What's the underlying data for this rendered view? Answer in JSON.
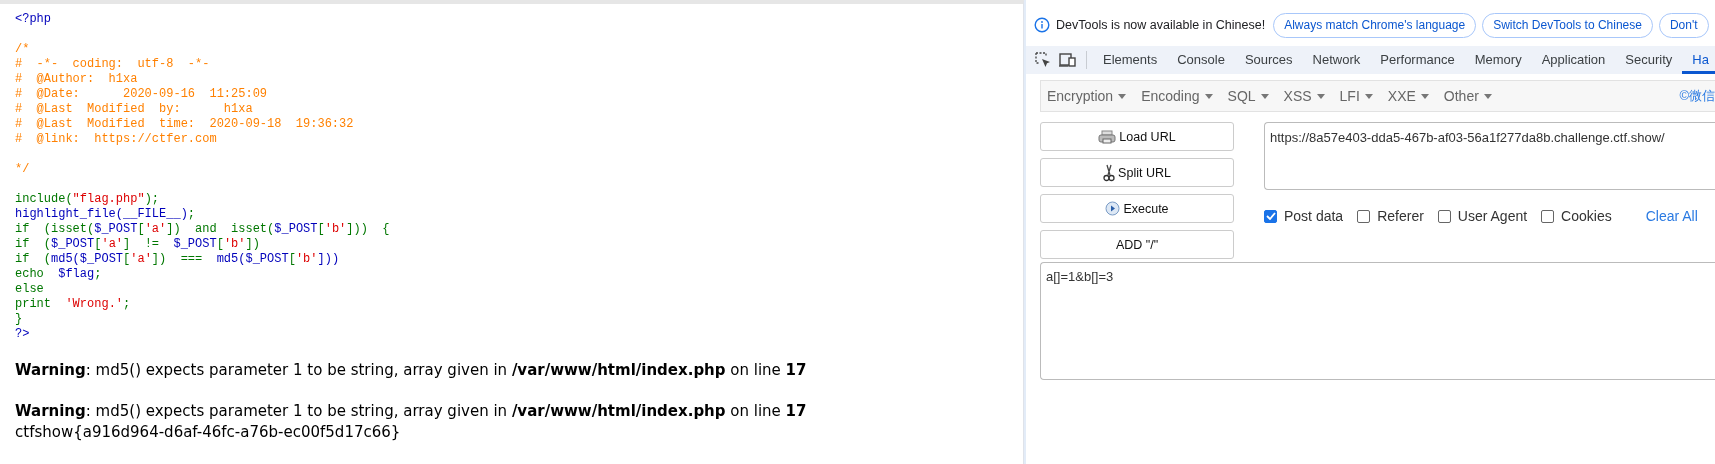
{
  "code": {
    "blocks": [
      {
        "lines": [
          [
            {
              "text": "<?php",
              "kind": "default"
            }
          ]
        ]
      },
      {
        "lines": [
          [
            {
              "text": "/*",
              "kind": "comment"
            }
          ],
          [
            {
              "text": "#  -*-  coding:  utf-8  -*-",
              "kind": "comment"
            }
          ],
          [
            {
              "text": "#  @Author:  h1xa",
              "kind": "comment"
            }
          ],
          [
            {
              "text": "#  @Date:      2020-09-16  11:25:09",
              "kind": "comment"
            }
          ],
          [
            {
              "text": "#  @Last  Modified  by:      h1xa",
              "kind": "comment"
            }
          ],
          [
            {
              "text": "#  @Last  Modified  time:  2020-09-18  19:36:32",
              "kind": "comment"
            }
          ],
          [
            {
              "text": "#  @link:  https://ctfer.com",
              "kind": "comment"
            }
          ]
        ]
      },
      {
        "lines": [
          [
            {
              "text": "*/",
              "kind": "comment"
            }
          ]
        ]
      },
      {
        "lines": [
          [
            {
              "text": "include(",
              "kind": "keyword"
            },
            {
              "text": "\"flag.php\"",
              "kind": "string"
            },
            {
              "text": ");",
              "kind": "keyword"
            }
          ],
          [
            {
              "text": "highlight_file(__FILE__)",
              "kind": "default"
            },
            {
              "text": ";",
              "kind": "keyword"
            }
          ],
          [
            {
              "text": "if  (isset(",
              "kind": "keyword"
            },
            {
              "text": "$_POST",
              "kind": "default"
            },
            {
              "text": "[",
              "kind": "keyword"
            },
            {
              "text": "'a'",
              "kind": "string"
            },
            {
              "text": "])  and  isset(",
              "kind": "keyword"
            },
            {
              "text": "$_POST",
              "kind": "default"
            },
            {
              "text": "[",
              "kind": "keyword"
            },
            {
              "text": "'b'",
              "kind": "string"
            },
            {
              "text": "]))  {",
              "kind": "keyword"
            }
          ],
          [
            {
              "text": "if  (",
              "kind": "keyword"
            },
            {
              "text": "$_POST",
              "kind": "default"
            },
            {
              "text": "[",
              "kind": "keyword"
            },
            {
              "text": "'a'",
              "kind": "string"
            },
            {
              "text": "]  !=  ",
              "kind": "keyword"
            },
            {
              "text": "$_POST",
              "kind": "default"
            },
            {
              "text": "[",
              "kind": "keyword"
            },
            {
              "text": "'b'",
              "kind": "string"
            },
            {
              "text": "])",
              "kind": "keyword"
            }
          ],
          [
            {
              "text": "if  (",
              "kind": "keyword"
            },
            {
              "text": "md5($_POST",
              "kind": "default"
            },
            {
              "text": "[",
              "kind": "keyword"
            },
            {
              "text": "'a'",
              "kind": "string"
            },
            {
              "text": "])  ===  ",
              "kind": "keyword"
            },
            {
              "text": "md5($_POST",
              "kind": "default"
            },
            {
              "text": "[",
              "kind": "keyword"
            },
            {
              "text": "'b'",
              "kind": "string"
            },
            {
              "text": "]))",
              "kind": "default"
            }
          ],
          [
            {
              "text": "echo  ",
              "kind": "keyword"
            },
            {
              "text": "$flag",
              "kind": "default"
            },
            {
              "text": ";",
              "kind": "keyword"
            }
          ],
          [
            {
              "text": "else",
              "kind": "keyword"
            }
          ],
          [
            {
              "text": "print  ",
              "kind": "keyword"
            },
            {
              "text": "'Wrong.'",
              "kind": "string"
            },
            {
              "text": ";",
              "kind": "keyword"
            }
          ],
          [
            {
              "text": "}",
              "kind": "keyword"
            }
          ],
          [
            {
              "text": "?>",
              "kind": "default"
            }
          ]
        ]
      }
    ]
  },
  "output": [
    {
      "lines": [
        "**Warning**: md5() expects parameter 1 to be string, array given in **/var/www/html/index.php** on line **17**"
      ]
    },
    {
      "lines": [
        "**Warning**: md5() expects parameter 1 to be string, array given in **/var/www/html/index.php** on line **17**",
        "ctfshow{a916d964-d6af-46fc-a76b-ec00f5d17c66}"
      ]
    }
  ],
  "devtools": {
    "infobar": {
      "message": "DevTools is now available in Chinese!",
      "buttons": [
        "Always match Chrome's language",
        "Switch DevTools to Chinese",
        "Don't"
      ]
    },
    "tabs": [
      {
        "label": "Elements",
        "selected": false
      },
      {
        "label": "Console",
        "selected": false
      },
      {
        "label": "Sources",
        "selected": false
      },
      {
        "label": "Network",
        "selected": false
      },
      {
        "label": "Performance",
        "selected": false
      },
      {
        "label": "Memory",
        "selected": false
      },
      {
        "label": "Application",
        "selected": false
      },
      {
        "label": "Security",
        "selected": false
      },
      {
        "label": "Ha",
        "selected": true
      }
    ],
    "hackbar": {
      "menus": [
        "Encryption",
        "Encoding",
        "SQL",
        "XSS",
        "LFI",
        "XXE",
        "Other"
      ],
      "credit": "©微信",
      "buttons": [
        {
          "label": "Load URL",
          "kind": "load"
        },
        {
          "label": "Split URL",
          "kind": "split"
        },
        {
          "label": "Execute",
          "kind": "execute"
        },
        {
          "label": "ADD \"/\"",
          "kind": "plain"
        }
      ],
      "url": "https://8a57e403-dda5-467b-af03-56a1f277da8b.challenge.ctf.show/",
      "options": [
        {
          "label": "Post data",
          "checked": true
        },
        {
          "label": "Referer",
          "checked": false
        },
        {
          "label": "User Agent",
          "checked": false
        },
        {
          "label": "Cookies",
          "checked": false
        }
      ],
      "clear": "Clear All",
      "post_data": "a[]=1&b[]=3"
    }
  }
}
